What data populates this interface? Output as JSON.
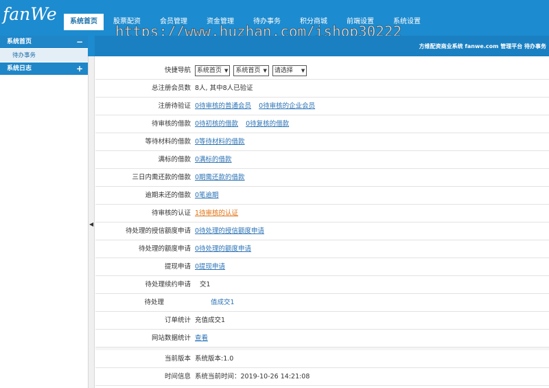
{
  "logo": {
    "text": "fanWe"
  },
  "watermark": "https://www.huzhan.com/ishop30222",
  "tabs": [
    {
      "label": "系统首页",
      "active": true
    },
    {
      "label": "股票配资",
      "active": false
    },
    {
      "label": "会员管理",
      "active": false
    },
    {
      "label": "资金管理",
      "active": false
    },
    {
      "label": "待办事务",
      "active": false
    },
    {
      "label": "积分商城",
      "active": false
    },
    {
      "label": "前端设置",
      "active": false
    },
    {
      "label": "系统设置",
      "active": false
    }
  ],
  "subbar": {
    "text": "方维配资商业系统 fanwe.com 管理平台 待办事务"
  },
  "sidebar": {
    "group1": {
      "title": "系统首页",
      "sign": "−"
    },
    "item1": "待办事务",
    "group2": {
      "title": "系统日志",
      "sign": "+"
    }
  },
  "rows": {
    "nav": {
      "label": "快捷导航",
      "sel1": "系统首页",
      "sel2": "系统首页",
      "sel3": "请选择"
    },
    "members": {
      "label": "总注册会员数",
      "value": "8人, 其中8人已验证"
    },
    "reg_verify": {
      "label": "注册待验证",
      "link1": "0待审核的普通会员",
      "link2": "0待审核的企业会员"
    },
    "pending_loans": {
      "label": "待审核的借款",
      "link1": "0待初核的借款",
      "link2": "0待复核的借款"
    },
    "material_loans": {
      "label": "等待材料的借款",
      "link1": "0等待材料的借款"
    },
    "full_loans": {
      "label": "满标的借款",
      "link1": "0满标的借款"
    },
    "repay3": {
      "label": "三日内需还款的借款",
      "link1": "0期需还款的借款"
    },
    "overdue": {
      "label": "逾期未还的借款",
      "link1": "0笔逾期"
    },
    "auth": {
      "label": "待审核的认证",
      "link1": "1待审核的认证"
    },
    "credit": {
      "label": "待处理的授信额度申请",
      "link1": "0待处理的授信额度申请"
    },
    "quota": {
      "label": "待处理的额度申请",
      "link1": "0待处理的额度申请"
    },
    "withdraw": {
      "label": "提现申请",
      "link1": "0提现申请"
    },
    "renew": {
      "label": "待处理续约申请",
      "value": "交1"
    },
    "pending_other": {
      "label": "待处理",
      "value": "值成交1"
    },
    "orders": {
      "label": "订单统计",
      "value": "充值成交1"
    },
    "site_stats": {
      "label": "网站数据统计",
      "link1": "查看"
    },
    "version": {
      "label": "当前版本",
      "value": "系统版本:1.0"
    },
    "time": {
      "label": "时间信息",
      "value": "系统当前时间：2019-10-26 14:21:08"
    }
  },
  "colors": {
    "header": "#1d8bcf",
    "link": "#2a72b5",
    "warn_link": "#e07010"
  }
}
